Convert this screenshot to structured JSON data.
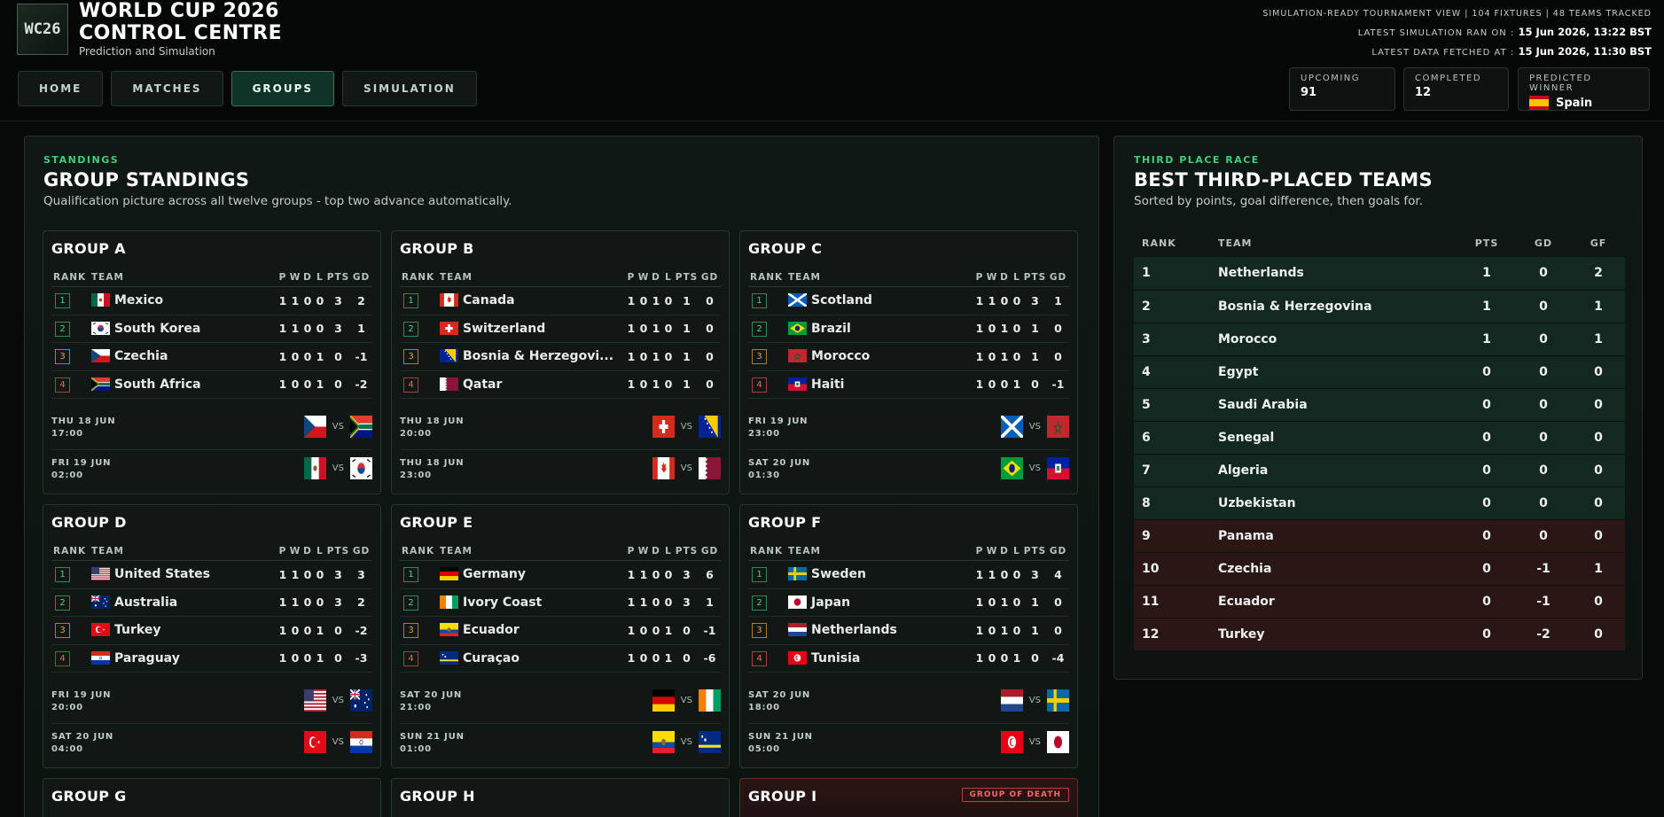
{
  "header": {
    "logo_text": "WC26",
    "title_line1": "WORLD CUP 2026",
    "title_line2": "CONTROL CENTRE",
    "subtitle": "Prediction and Simulation",
    "meta_line1": "SIMULATION-READY TOURNAMENT VIEW  |  104 FIXTURES  |  48 TEAMS TRACKED",
    "meta_sim_label": "LATEST SIMULATION RAN ON :",
    "meta_sim_value": "15 Jun 2026, 13:22 BST",
    "meta_fetch_label": "LATEST DATA FETCHED AT :",
    "meta_fetch_value": "15 Jun 2026, 11:30 BST"
  },
  "nav": {
    "home": "HOME",
    "matches": "MATCHES",
    "groups": "GROUPS",
    "simulation": "SIMULATION",
    "active": "groups"
  },
  "stats": {
    "upcoming_label": "UPCOMING",
    "upcoming_value": "91",
    "completed_label": "COMPLETED",
    "completed_value": "12",
    "winner_label": "PREDICTED WINNER",
    "winner_value": "Spain",
    "winner_flag": "flag-spain"
  },
  "standings": {
    "kicker": "STANDINGS",
    "title": "GROUP STANDINGS",
    "subtitle": "Qualification picture across all twelve groups - top two advance automatically.",
    "columns": [
      "RANK",
      "TEAM",
      "P",
      "W",
      "D",
      "L",
      "PTS",
      "GD"
    ],
    "groups": [
      {
        "name": "GROUP A",
        "rows": [
          {
            "rank": "1",
            "team": "Mexico",
            "flag": "mx",
            "p": "1",
            "w": "1",
            "d": "0",
            "l": "0",
            "pts": "3",
            "gd": "2"
          },
          {
            "rank": "2",
            "team": "South Korea",
            "flag": "kr",
            "p": "1",
            "w": "1",
            "d": "0",
            "l": "0",
            "pts": "3",
            "gd": "1"
          },
          {
            "rank": "3",
            "team": "Czechia",
            "flag": "cz",
            "p": "1",
            "w": "0",
            "d": "0",
            "l": "1",
            "pts": "0",
            "gd": "-1"
          },
          {
            "rank": "4",
            "team": "South Africa",
            "flag": "za",
            "p": "1",
            "w": "0",
            "d": "0",
            "l": "1",
            "pts": "0",
            "gd": "-2"
          }
        ],
        "fixtures": [
          {
            "day": "THU 18 JUN",
            "time": "17:00",
            "home": "cz",
            "away": "za"
          },
          {
            "day": "FRI 19 JUN",
            "time": "02:00",
            "home": "mx",
            "away": "kr"
          }
        ]
      },
      {
        "name": "GROUP B",
        "rows": [
          {
            "rank": "1",
            "team": "Canada",
            "flag": "ca",
            "p": "1",
            "w": "0",
            "d": "1",
            "l": "0",
            "pts": "1",
            "gd": "0"
          },
          {
            "rank": "2",
            "team": "Switzerland",
            "flag": "ch",
            "p": "1",
            "w": "0",
            "d": "1",
            "l": "0",
            "pts": "1",
            "gd": "0"
          },
          {
            "rank": "3",
            "team": "Bosnia & Herzegovi...",
            "flag": "ba",
            "p": "1",
            "w": "0",
            "d": "1",
            "l": "0",
            "pts": "1",
            "gd": "0"
          },
          {
            "rank": "4",
            "team": "Qatar",
            "flag": "qa",
            "p": "1",
            "w": "0",
            "d": "1",
            "l": "0",
            "pts": "1",
            "gd": "0"
          }
        ],
        "fixtures": [
          {
            "day": "THU 18 JUN",
            "time": "20:00",
            "home": "ch",
            "away": "ba"
          },
          {
            "day": "THU 18 JUN",
            "time": "23:00",
            "home": "ca",
            "away": "qa"
          }
        ]
      },
      {
        "name": "GROUP C",
        "rows": [
          {
            "rank": "1",
            "team": "Scotland",
            "flag": "sco",
            "p": "1",
            "w": "1",
            "d": "0",
            "l": "0",
            "pts": "3",
            "gd": "1"
          },
          {
            "rank": "2",
            "team": "Brazil",
            "flag": "br",
            "p": "1",
            "w": "0",
            "d": "1",
            "l": "0",
            "pts": "1",
            "gd": "0"
          },
          {
            "rank": "3",
            "team": "Morocco",
            "flag": "ma",
            "p": "1",
            "w": "0",
            "d": "1",
            "l": "0",
            "pts": "1",
            "gd": "0"
          },
          {
            "rank": "4",
            "team": "Haiti",
            "flag": "ht",
            "p": "1",
            "w": "0",
            "d": "0",
            "l": "1",
            "pts": "0",
            "gd": "-1"
          }
        ],
        "fixtures": [
          {
            "day": "FRI 19 JUN",
            "time": "23:00",
            "home": "sco",
            "away": "ma"
          },
          {
            "day": "SAT 20 JUN",
            "time": "01:30",
            "home": "br",
            "away": "ht"
          }
        ]
      },
      {
        "name": "GROUP D",
        "rows": [
          {
            "rank": "1",
            "team": "United States",
            "flag": "us",
            "p": "1",
            "w": "1",
            "d": "0",
            "l": "0",
            "pts": "3",
            "gd": "3"
          },
          {
            "rank": "2",
            "team": "Australia",
            "flag": "au",
            "p": "1",
            "w": "1",
            "d": "0",
            "l": "0",
            "pts": "3",
            "gd": "2"
          },
          {
            "rank": "3",
            "team": "Turkey",
            "flag": "tr",
            "p": "1",
            "w": "0",
            "d": "0",
            "l": "1",
            "pts": "0",
            "gd": "-2"
          },
          {
            "rank": "4",
            "team": "Paraguay",
            "flag": "py",
            "p": "1",
            "w": "0",
            "d": "0",
            "l": "1",
            "pts": "0",
            "gd": "-3"
          }
        ],
        "fixtures": [
          {
            "day": "FRI 19 JUN",
            "time": "20:00",
            "home": "us",
            "away": "au"
          },
          {
            "day": "SAT 20 JUN",
            "time": "04:00",
            "home": "tr",
            "away": "py"
          }
        ]
      },
      {
        "name": "GROUP E",
        "rows": [
          {
            "rank": "1",
            "team": "Germany",
            "flag": "de",
            "p": "1",
            "w": "1",
            "d": "0",
            "l": "0",
            "pts": "3",
            "gd": "6"
          },
          {
            "rank": "2",
            "team": "Ivory Coast",
            "flag": "ci",
            "p": "1",
            "w": "1",
            "d": "0",
            "l": "0",
            "pts": "3",
            "gd": "1"
          },
          {
            "rank": "3",
            "team": "Ecuador",
            "flag": "ec",
            "p": "1",
            "w": "0",
            "d": "0",
            "l": "1",
            "pts": "0",
            "gd": "-1"
          },
          {
            "rank": "4",
            "team": "Curaçao",
            "flag": "cw",
            "p": "1",
            "w": "0",
            "d": "0",
            "l": "1",
            "pts": "0",
            "gd": "-6"
          }
        ],
        "fixtures": [
          {
            "day": "SAT 20 JUN",
            "time": "21:00",
            "home": "de",
            "away": "ci"
          },
          {
            "day": "SUN 21 JUN",
            "time": "01:00",
            "home": "ec",
            "away": "cw"
          }
        ]
      },
      {
        "name": "GROUP F",
        "rows": [
          {
            "rank": "1",
            "team": "Sweden",
            "flag": "se",
            "p": "1",
            "w": "1",
            "d": "0",
            "l": "0",
            "pts": "3",
            "gd": "4"
          },
          {
            "rank": "2",
            "team": "Japan",
            "flag": "jp",
            "p": "1",
            "w": "0",
            "d": "1",
            "l": "0",
            "pts": "1",
            "gd": "0"
          },
          {
            "rank": "3",
            "team": "Netherlands",
            "flag": "nl",
            "p": "1",
            "w": "0",
            "d": "1",
            "l": "0",
            "pts": "1",
            "gd": "0"
          },
          {
            "rank": "4",
            "team": "Tunisia",
            "flag": "tn",
            "p": "1",
            "w": "0",
            "d": "0",
            "l": "1",
            "pts": "0",
            "gd": "-4"
          }
        ],
        "fixtures": [
          {
            "day": "SAT 20 JUN",
            "time": "18:00",
            "home": "nl",
            "away": "se"
          },
          {
            "day": "SUN 21 JUN",
            "time": "05:00",
            "home": "tn",
            "away": "jp"
          }
        ]
      }
    ],
    "partial_groups": [
      {
        "name": "GROUP G"
      },
      {
        "name": "GROUP H"
      },
      {
        "name": "GROUP I",
        "badge": "GROUP OF DEATH"
      }
    ],
    "vs_label": "VS"
  },
  "third_place": {
    "kicker": "THIRD PLACE RACE",
    "title": "BEST THIRD-PLACED TEAMS",
    "subtitle": "Sorted by points, goal difference, then goals for.",
    "columns": [
      "RANK",
      "TEAM",
      "PTS",
      "GD",
      "GF"
    ],
    "rows": [
      {
        "rank": "1",
        "team": "Netherlands",
        "pts": "1",
        "gd": "0",
        "gf": "2",
        "qualifies": true
      },
      {
        "rank": "2",
        "team": "Bosnia & Herzegovina",
        "pts": "1",
        "gd": "0",
        "gf": "1",
        "qualifies": true
      },
      {
        "rank": "3",
        "team": "Morocco",
        "pts": "1",
        "gd": "0",
        "gf": "1",
        "qualifies": true
      },
      {
        "rank": "4",
        "team": "Egypt",
        "pts": "0",
        "gd": "0",
        "gf": "0",
        "qualifies": true
      },
      {
        "rank": "5",
        "team": "Saudi Arabia",
        "pts": "0",
        "gd": "0",
        "gf": "0",
        "qualifies": true
      },
      {
        "rank": "6",
        "team": "Senegal",
        "pts": "0",
        "gd": "0",
        "gf": "0",
        "qualifies": true
      },
      {
        "rank": "7",
        "team": "Algeria",
        "pts": "0",
        "gd": "0",
        "gf": "0",
        "qualifies": true
      },
      {
        "rank": "8",
        "team": "Uzbekistan",
        "pts": "0",
        "gd": "0",
        "gf": "0",
        "qualifies": true
      },
      {
        "rank": "9",
        "team": "Panama",
        "pts": "0",
        "gd": "0",
        "gf": "0",
        "qualifies": false
      },
      {
        "rank": "10",
        "team": "Czechia",
        "pts": "0",
        "gd": "-1",
        "gf": "1",
        "qualifies": false
      },
      {
        "rank": "11",
        "team": "Ecuador",
        "pts": "0",
        "gd": "-1",
        "gf": "0",
        "qualifies": false
      },
      {
        "rank": "12",
        "team": "Turkey",
        "pts": "0",
        "gd": "-2",
        "gf": "0",
        "qualifies": false
      }
    ]
  },
  "colors": {
    "accent": "#3fcf7b",
    "qualify_row": "#132820",
    "eliminate_row": "#2a1614",
    "rank3": "#e1a14e",
    "rank4": "#ea6860"
  }
}
